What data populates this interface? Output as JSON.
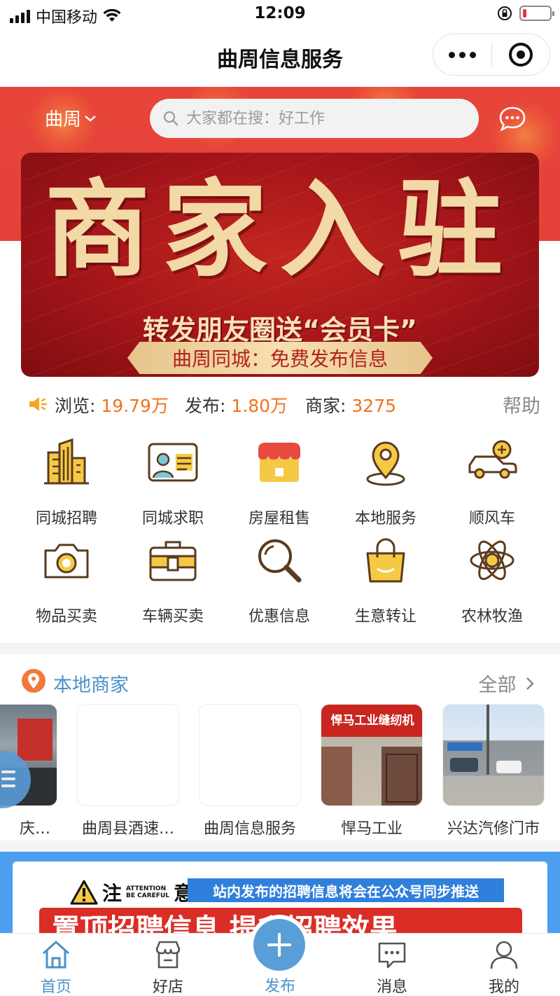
{
  "status_bar": {
    "carrier": "中国移动",
    "time": "12:09"
  },
  "nav": {
    "title": "曲周信息服务"
  },
  "header": {
    "city": "曲周",
    "search_placeholder": "大家都在搜：好工作"
  },
  "banner": {
    "title": "商家入驻",
    "subtitle": "转发朋友圈送“会员卡”",
    "ribbon": "曲周同城：免费发布信息"
  },
  "stats": {
    "views_label": "浏览:",
    "views_value": "19.79万",
    "posts_label": "发布:",
    "posts_value": "1.80万",
    "merchants_label": "商家:",
    "merchants_value": "3275",
    "help": "帮助"
  },
  "categories": [
    {
      "label": "同城招聘",
      "icon": "buildings-icon"
    },
    {
      "label": "同城求职",
      "icon": "id-card-icon"
    },
    {
      "label": "房屋租售",
      "icon": "shop-icon"
    },
    {
      "label": "本地服务",
      "icon": "location-pin-icon"
    },
    {
      "label": "顺风车",
      "icon": "car-icon"
    },
    {
      "label": "物品买卖",
      "icon": "camera-icon"
    },
    {
      "label": "车辆买卖",
      "icon": "briefcase-icon"
    },
    {
      "label": "优惠信息",
      "icon": "magnifier-icon"
    },
    {
      "label": "生意转让",
      "icon": "shopping-bag-icon"
    },
    {
      "label": "农林牧渔",
      "icon": "atom-icon"
    }
  ],
  "local_merchants": {
    "title": "本地商家",
    "more": "全部",
    "items": [
      {
        "name": "庆…"
      },
      {
        "name": "曲周县酒速…"
      },
      {
        "name": "曲周信息服务"
      },
      {
        "name": "悍马工业",
        "sign": "悍马工业缝纫机"
      },
      {
        "name": "兴达汽修门市"
      }
    ]
  },
  "notice": {
    "attention_big_1": "注",
    "attention_small_1": "ATTENTION",
    "attention_small_2": "BE CAREFUL",
    "attention_big_2": "意",
    "bar_text": "站内发布的招聘信息将会在公众号同步推送",
    "red_text": "置顶招聘信息 提升招聘效果"
  },
  "tab_bar": {
    "items": [
      {
        "label": "首页",
        "icon": "home-icon"
      },
      {
        "label": "好店",
        "icon": "store-icon"
      },
      {
        "label": "发布",
        "icon": "plus-icon"
      },
      {
        "label": "消息",
        "icon": "message-icon"
      },
      {
        "label": "我的",
        "icon": "user-icon"
      }
    ]
  },
  "colors": {
    "hero_red": "#e8453a",
    "stat_orange": "#f2711c",
    "accent_blue": "#4a90c8",
    "icon_gold": "#f6c945",
    "icon_brown": "#5b3a1e"
  }
}
